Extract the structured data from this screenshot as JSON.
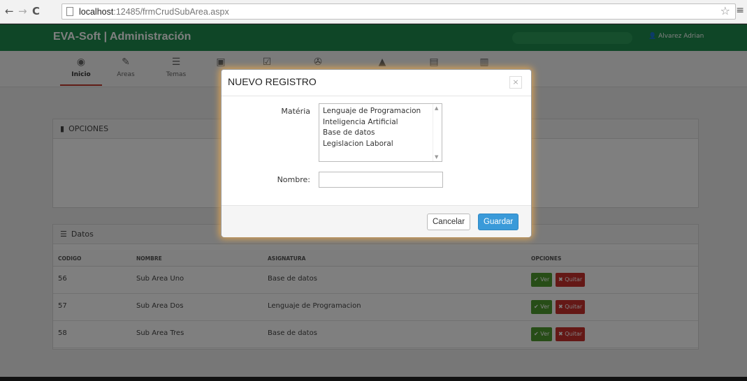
{
  "browser": {
    "url_host": "localhost",
    "url_rest": ":12485/frmCrudSubArea.aspx"
  },
  "app": {
    "brand": "EVA-Soft | Administración",
    "user": "Alvarez Adrian"
  },
  "iconbar": [
    {
      "label": "Inicio",
      "icon": "dashboard-icon"
    },
    {
      "label": "Areas",
      "icon": "edit-icon"
    },
    {
      "label": "Temas",
      "icon": "list-icon"
    },
    {
      "label": "",
      "icon": "book-icon"
    },
    {
      "label": "",
      "icon": "check-icon"
    },
    {
      "label": "",
      "icon": "wrench-icon"
    },
    {
      "label": "",
      "icon": "user-icon"
    },
    {
      "label": "",
      "icon": "calendar-icon"
    },
    {
      "label": "",
      "icon": "chart-icon"
    }
  ],
  "opciones_panel": {
    "title": "OPCIONES"
  },
  "datos_panel": {
    "title": "Datos",
    "headers": [
      "CODIGO",
      "NOMBRE",
      "ASIGNATURA",
      "OPCIONES"
    ],
    "rows": [
      {
        "codigo": "56",
        "nombre": "Sub Area Uno",
        "asignatura": "Base de datos"
      },
      {
        "codigo": "57",
        "nombre": "Sub Area Dos",
        "asignatura": "Lenguaje de Programacion"
      },
      {
        "codigo": "58",
        "nombre": "Sub Area Tres",
        "asignatura": "Base de datos"
      }
    ],
    "ver_label": "✔ Ver",
    "quitar_label": "✖ Quitar"
  },
  "modal": {
    "title": "NUEVO REGISTRO",
    "close": "×",
    "materia_label": "Matéria",
    "materia_options": [
      "Lenguaje de Programacion",
      "Inteligencia Artificial",
      "Base de datos",
      "Legislacion Laboral"
    ],
    "nombre_label": "Nombre:",
    "nombre_value": "",
    "cancel_label": "Cancelar",
    "save_label": "Guardar"
  },
  "colors": {
    "topbar": "#1f8d4e",
    "primary_button": "#3a9ad9",
    "ver_button": "#4f9a2f",
    "quitar_button": "#c9302c",
    "modal_glow": "#f0ad4e"
  }
}
